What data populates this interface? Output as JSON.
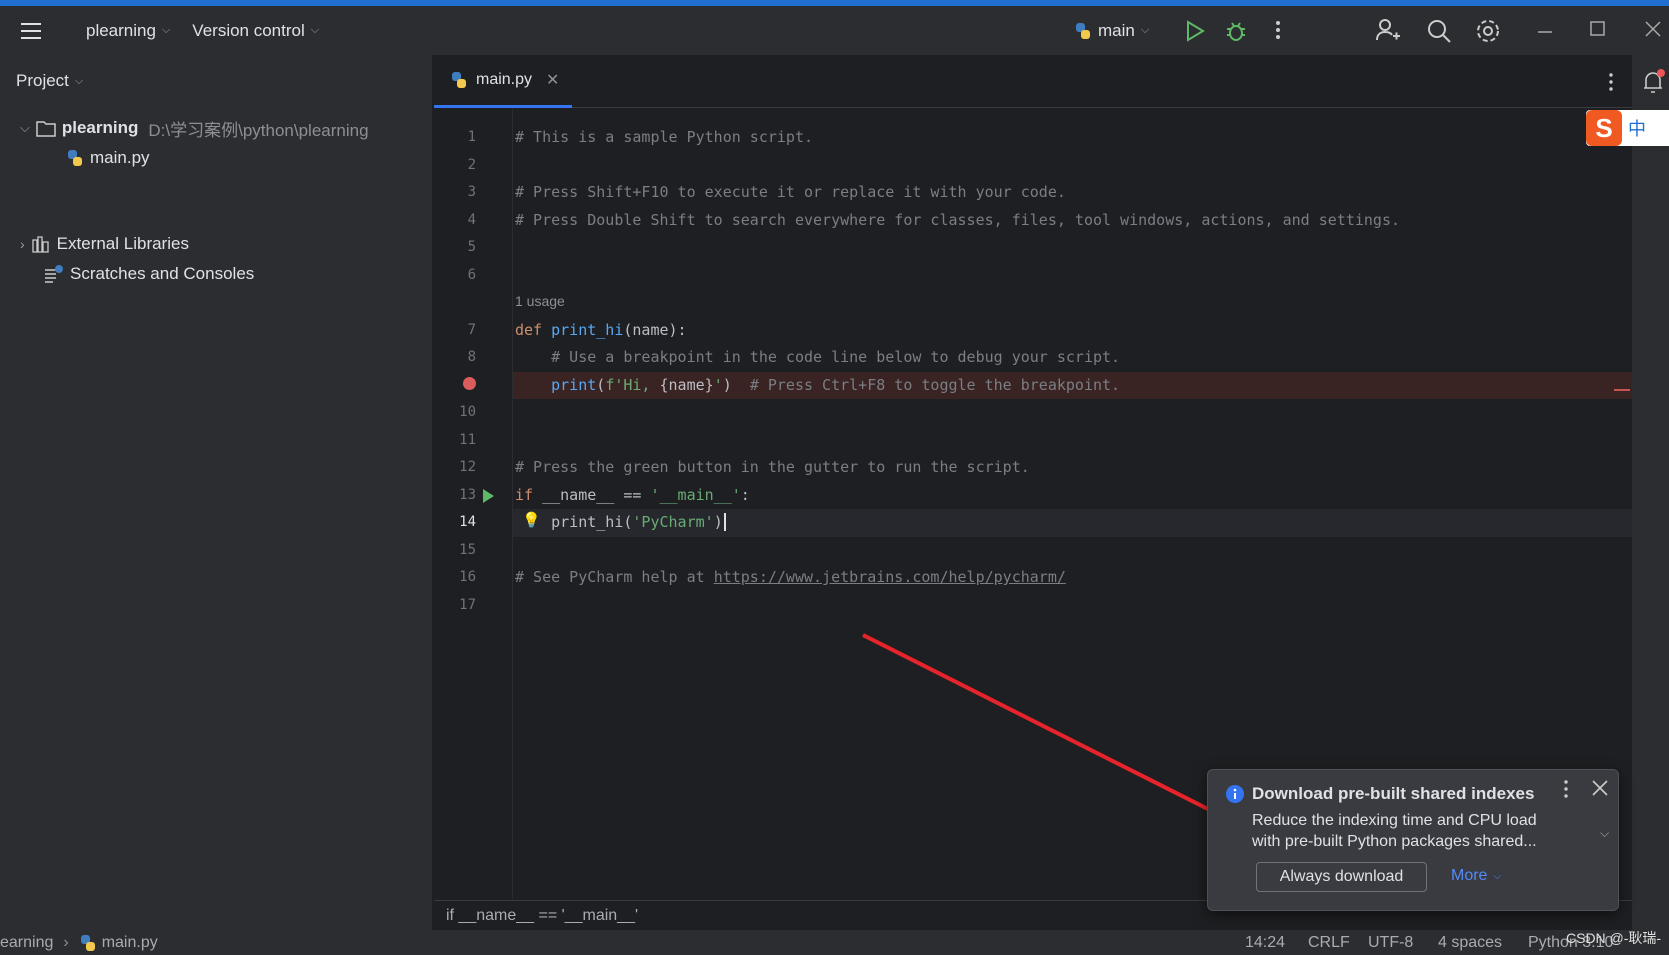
{
  "topbar": {
    "project": "plearning",
    "vcs": "Version control",
    "run_config": "main"
  },
  "sidebar": {
    "title": "Project",
    "items": [
      {
        "label": "plearning",
        "path": "D:\\学习案例\\python\\plearning"
      },
      {
        "label": "main.py"
      },
      {
        "label": "External Libraries"
      },
      {
        "label": "Scratches and Consoles"
      }
    ]
  },
  "editor": {
    "tab": "main.py",
    "usage_hint": "1 usage",
    "current_line": 14,
    "lines": [
      [
        [
          "# This is a sample Python script.",
          "c"
        ]
      ],
      [],
      [
        [
          "# Press Shift+F10 to execute it or replace it with your code.",
          "c"
        ]
      ],
      [
        [
          "# Press Double Shift to search everywhere for classes, files, tool windows, actions, and settings.",
          "c"
        ]
      ],
      [],
      [],
      [
        [
          "def ",
          "k"
        ],
        [
          "print_hi",
          "f"
        ],
        [
          "(name):",
          ""
        ]
      ],
      [
        [
          "    # Use a breakpoint in the code line below to debug your script.",
          "c"
        ]
      ],
      [
        [
          "    ",
          ""
        ],
        [
          "print",
          "f"
        ],
        [
          "(",
          ""
        ],
        [
          "f'Hi, ",
          "s"
        ],
        [
          "{",
          ""
        ],
        [
          "name",
          ""
        ],
        [
          "}",
          ""
        ],
        [
          "'",
          "s"
        ],
        [
          ")  ",
          ""
        ],
        [
          "# Press Ctrl+F8 to toggle the breakpoint.",
          "c"
        ]
      ],
      [],
      [],
      [
        [
          "# Press the green button in the gutter to run the script.",
          "c"
        ]
      ],
      [
        [
          "if ",
          "k"
        ],
        [
          "__name__ == ",
          ""
        ],
        [
          "'__main__'",
          "s"
        ],
        [
          ":",
          ""
        ]
      ],
      [
        [
          "    print_hi(",
          ""
        ],
        [
          "'PyCharm'",
          "s"
        ],
        [
          ")",
          ""
        ]
      ],
      [],
      [
        [
          "# See PyCharm help at ",
          "c"
        ],
        [
          "https://www.jetbrains.com/help/pycharm/",
          "u"
        ]
      ],
      []
    ],
    "breadcrumb": "if __name__ == '__main__'"
  },
  "notification": {
    "title": "Download pre-built shared indexes",
    "body1": "Reduce the indexing time and CPU load",
    "body2": "with pre-built Python packages shared...",
    "primary": "Always download",
    "more": "More"
  },
  "statusbar": {
    "path_project": "earning",
    "path_file": "main.py",
    "position": "14:24",
    "line_sep": "CRLF",
    "encoding": "UTF-8",
    "indent": "4 spaces",
    "interpreter": "Python 3.10"
  },
  "watermark": "CSDN @-耿瑞-",
  "colors": {
    "accent": "#3574f0",
    "breakpoint": "#db5c5c",
    "run": "#5fb865"
  }
}
